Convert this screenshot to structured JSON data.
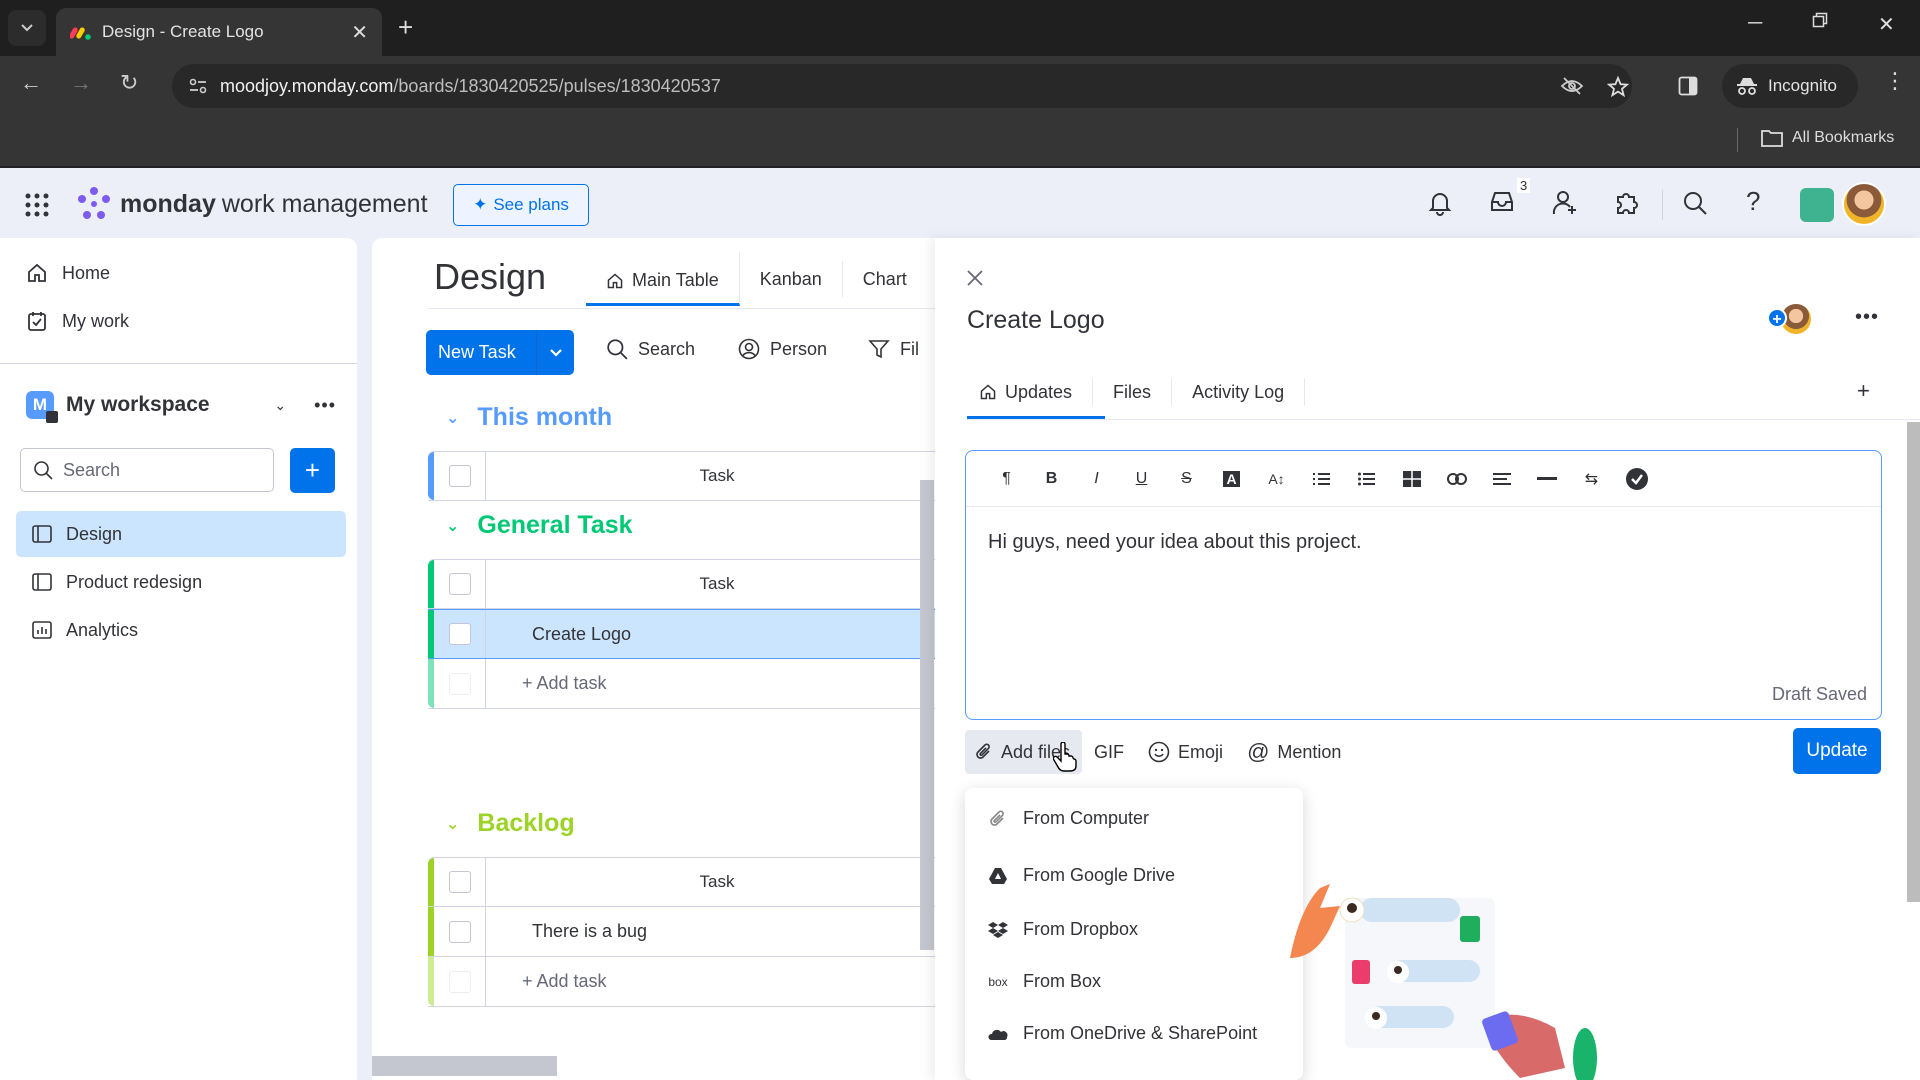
{
  "browser": {
    "tab_title": "Design - Create Logo",
    "url_host": "moodjoy.monday.com",
    "url_path": "/boards/1830420525/pulses/1830420537",
    "incognito_label": "Incognito",
    "bookmarks_label": "All Bookmarks"
  },
  "header": {
    "brand": "monday",
    "product": "work management",
    "see_plans": "See plans",
    "inbox_count": "3"
  },
  "sidebar": {
    "nav": [
      {
        "label": "Home",
        "icon": "home-icon"
      },
      {
        "label": "My work",
        "icon": "calendar-check-icon"
      }
    ],
    "workspace": {
      "initial": "M",
      "name": "My workspace"
    },
    "search_placeholder": "Search",
    "boards": [
      {
        "label": "Design",
        "icon": "board-icon",
        "active": true
      },
      {
        "label": "Product redesign",
        "icon": "board-icon",
        "active": false
      },
      {
        "label": "Analytics",
        "icon": "dashboard-icon",
        "active": false
      }
    ]
  },
  "board": {
    "title": "Design",
    "views": [
      "Main Table",
      "Kanban",
      "Chart"
    ],
    "new_task": "New Task",
    "tools": {
      "search": "Search",
      "person": "Person",
      "filter": "Fil"
    },
    "groups": [
      {
        "title": "This month",
        "color": "#579bfc",
        "header": "Task",
        "tasks": [],
        "add_label": null
      },
      {
        "title": "General Task",
        "color": "#00c875",
        "header": "Task",
        "tasks": [
          "Create Logo"
        ],
        "add_label": "+ Add task"
      },
      {
        "title": "Backlog",
        "color": "#9cd326",
        "header": "Task",
        "tasks": [
          "There is a bug"
        ],
        "add_label": "+ Add task"
      }
    ]
  },
  "panel": {
    "title": "Create Logo",
    "tabs": [
      "Updates",
      "Files",
      "Activity Log"
    ],
    "editor_text": "Hi guys, need your idea about this project.",
    "draft_status": "Draft Saved",
    "actions": {
      "add_files": "Add files",
      "gif": "GIF",
      "emoji": "Emoji",
      "mention": "Mention"
    },
    "update_button": "Update",
    "files_menu": [
      {
        "label": "From Computer",
        "icon": "paperclip-icon"
      },
      {
        "label": "From Google Drive",
        "icon": "google-drive-icon"
      },
      {
        "label": "From Dropbox",
        "icon": "dropbox-icon"
      },
      {
        "label": "From Box",
        "icon": "box-icon"
      },
      {
        "label": "From OneDrive & SharePoint",
        "icon": "onedrive-icon"
      }
    ]
  },
  "colors": {
    "accent": "#0073ea",
    "selected_row": "#cce5ff",
    "this_month": "#579bfc",
    "general_task": "#00c875",
    "backlog": "#9cd326"
  }
}
